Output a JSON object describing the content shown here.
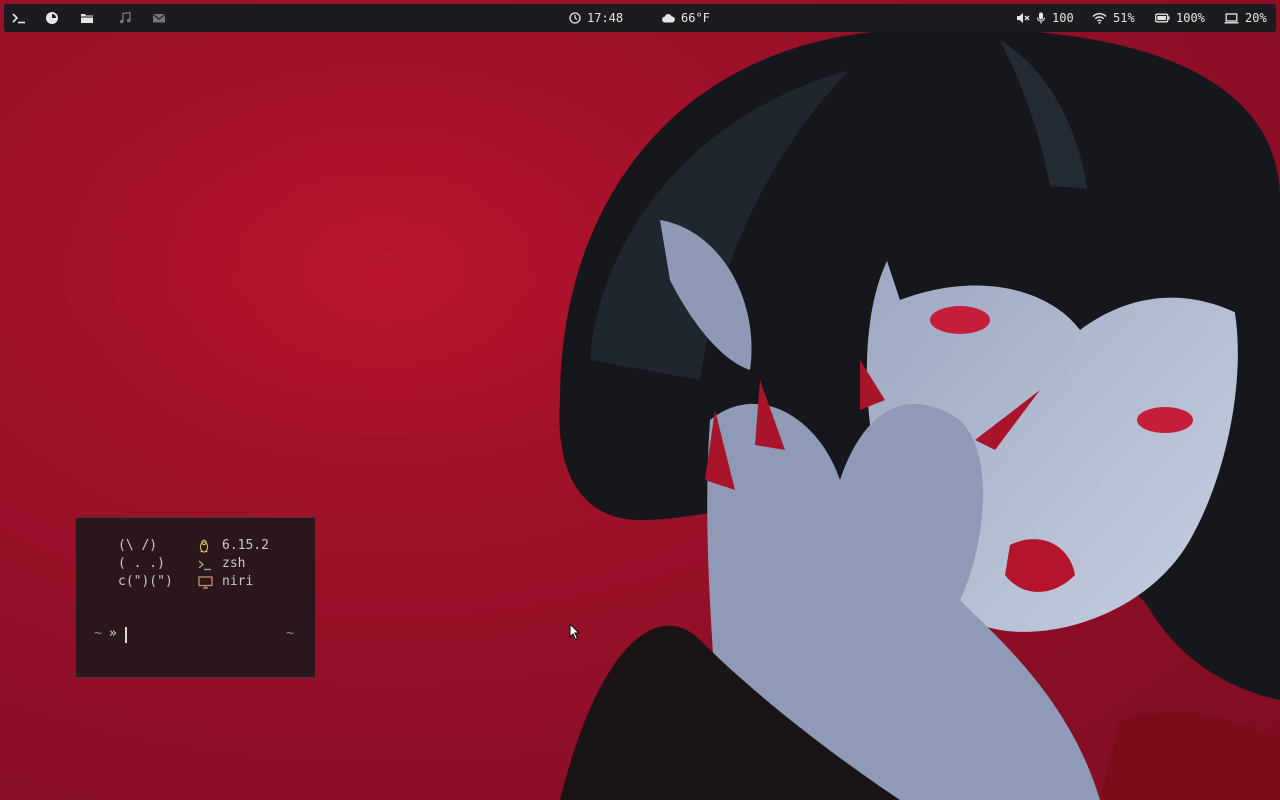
{
  "topbar": {
    "clock": "17:48",
    "weather": "66°F",
    "volume": "100",
    "wifi": "51%",
    "battery": "100%",
    "brightness": "20%",
    "workspaces": [
      "terminal-icon",
      "browser-icon",
      "folder-icon",
      "music-icon",
      "mail-icon"
    ]
  },
  "terminal": {
    "ascii_art": [
      "(\\ /)",
      "( . .)",
      "c(\")(\")"
    ],
    "kernel": "6.15.2",
    "shell": "zsh",
    "wm": "niri",
    "prompt_path": "~",
    "prompt_symbol": "»",
    "right_prompt": "~"
  },
  "colors": {
    "wallpaper": "#a8122c",
    "bar_bg": "#1c1c20",
    "terminal_bg": "#2a171b",
    "accent_yellow": "#d9b862",
    "accent_green": "#8fa86b",
    "accent_orange": "#c98a63"
  }
}
